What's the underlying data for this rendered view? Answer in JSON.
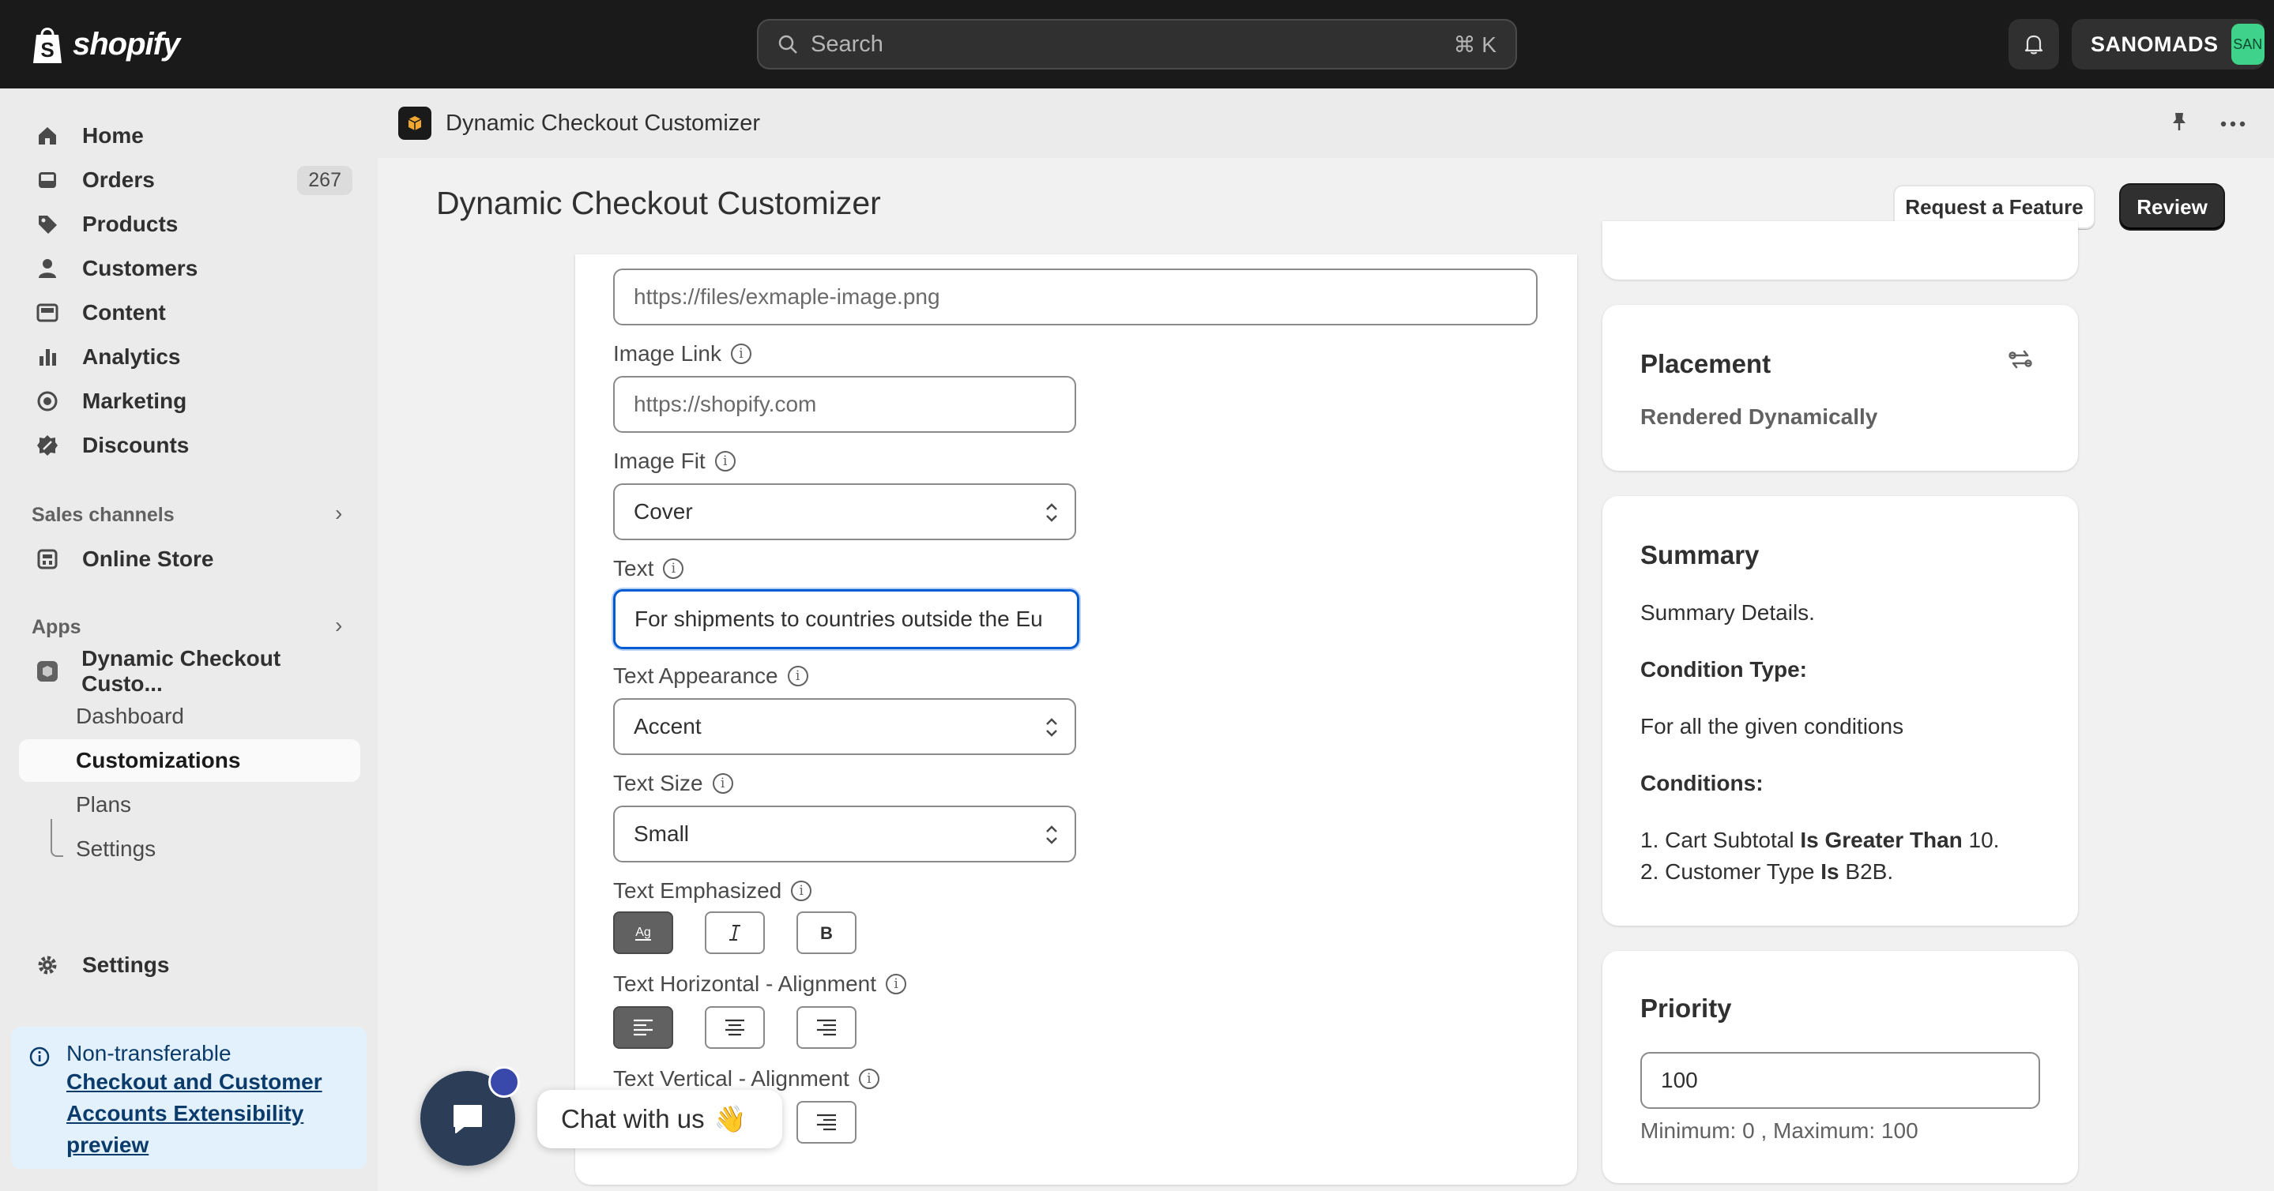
{
  "topbar": {
    "logo_text": "shopify",
    "search_placeholder": "Search",
    "search_shortcut": "⌘ K",
    "store_name": "SANOMADS",
    "store_avatar": "SAN"
  },
  "sidebar": {
    "items": [
      {
        "label": "Home",
        "icon": "home-icon"
      },
      {
        "label": "Orders",
        "icon": "inbox-icon",
        "badge": "267"
      },
      {
        "label": "Products",
        "icon": "tag-icon"
      },
      {
        "label": "Customers",
        "icon": "person-icon"
      },
      {
        "label": "Content",
        "icon": "image-icon"
      },
      {
        "label": "Analytics",
        "icon": "bar-chart-icon"
      },
      {
        "label": "Marketing",
        "icon": "target-icon"
      },
      {
        "label": "Discounts",
        "icon": "discount-icon"
      }
    ],
    "sales_channels_title": "Sales channels",
    "online_store": "Online Store",
    "apps_title": "Apps",
    "app_name": "Dynamic Checkout Custo...",
    "app_subitems": [
      "Dashboard",
      "Customizations",
      "Plans",
      "Settings"
    ],
    "settings": "Settings",
    "notice": {
      "title": "Non-transferable",
      "link": "Checkout and Customer Accounts Extensibility preview"
    }
  },
  "appbar": {
    "name": "Dynamic Checkout Customizer"
  },
  "page": {
    "title": "Dynamic Checkout Customizer",
    "request_button": "Request a Feature",
    "review_button": "Review"
  },
  "form": {
    "image_url_value": "https://files/exmaple-image.png",
    "image_link_label": "Image Link",
    "image_link_placeholder": "https://shopify.com",
    "image_fit_label": "Image Fit",
    "image_fit_value": "Cover",
    "text_label": "Text",
    "text_value": "For shipments to countries outside the Eu",
    "text_appearance_label": "Text Appearance",
    "text_appearance_value": "Accent",
    "text_size_label": "Text Size",
    "text_size_value": "Small",
    "text_emphasized_label": "Text Emphasized",
    "text_h_align_label": "Text Horizontal - Alignment",
    "text_v_align_label": "Text Vertical - Alignment"
  },
  "placement": {
    "title": "Placement",
    "value": "Rendered Dynamically"
  },
  "summary": {
    "title": "Summary",
    "details": "Summary Details.",
    "condition_type_label": "Condition Type:",
    "condition_type_value": "For all the given conditions",
    "conditions_label": "Conditions:",
    "cond1_prefix": "1. Cart Subtotal",
    "cond1_op": "Is Greater Than",
    "cond1_val": "10.",
    "cond2_prefix": "2. Customer Type",
    "cond2_op": "Is",
    "cond2_val": "B2B."
  },
  "priority": {
    "title": "Priority",
    "value": "100",
    "help": "Minimum: 0 , Maximum: 100"
  },
  "chat": {
    "label": "Chat with us",
    "emoji": "👋"
  }
}
